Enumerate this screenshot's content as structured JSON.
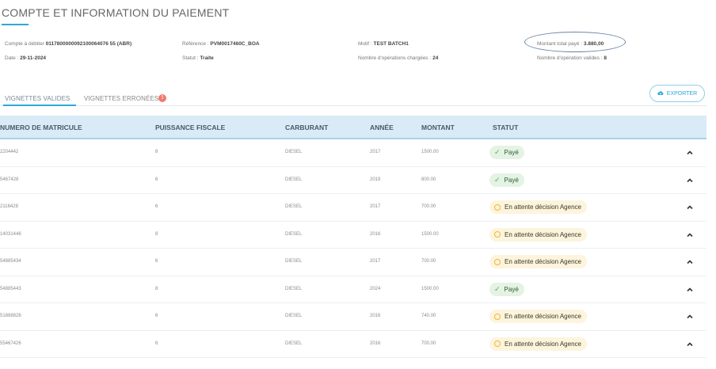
{
  "page": {
    "title": "COMPTE ET INFORMATION DU PAIEMENT"
  },
  "info": {
    "compte_label": "Compte à débiter",
    "compte_value": "0117800000092100064076 55 (ABR)",
    "date_label": "Date :",
    "date_value": "29-11-2024",
    "reference_label": "Référence :",
    "reference_value": "PVM0017460C_BOA",
    "statut_label": "Statut :",
    "statut_value": "Traite",
    "motif_label": "Motif :",
    "motif_value": "TEST BATCH1",
    "nb_chargees_label": "Nombre d'opérations chargées :",
    "nb_chargees_value": "24",
    "montant_label": "Montant total payé :",
    "montant_value": "3.880,00",
    "nb_valides_label": "Nombre d'opération valides :",
    "nb_valides_value": "8"
  },
  "tabs": [
    {
      "label": "VIGNETTES VALIDES"
    },
    {
      "label": "VIGNETTES ERRONÉES",
      "badge": "!"
    }
  ],
  "export_label": "EXPORTER",
  "table": {
    "headers": [
      "NUMERO DE MATRICULE",
      "PUISSANCE FISCALE",
      "CARBURANT",
      "ANNÉE",
      "MONTANT",
      "STATUT"
    ],
    "rows": [
      {
        "matricule": "2204442",
        "puissance": "8",
        "carburant": "DIESEL",
        "annee": "2017",
        "montant": "1500.00",
        "statut": "Payé",
        "type": "ok"
      },
      {
        "matricule": "5467428",
        "puissance": "6",
        "carburant": "DIESEL",
        "annee": "2019",
        "montant": "800.00",
        "statut": "Payé",
        "type": "ok"
      },
      {
        "matricule": "2116428",
        "puissance": "6",
        "carburant": "DIESEL",
        "annee": "2017",
        "montant": "700.00",
        "statut": "En attente décision Agence",
        "type": "wait"
      },
      {
        "matricule": "14031446",
        "puissance": "8",
        "carburant": "DIESEL",
        "annee": "2016",
        "montant": "1500.00",
        "statut": "En attente décision Agence",
        "type": "wait"
      },
      {
        "matricule": "54885434",
        "puissance": "6",
        "carburant": "DIESEL",
        "annee": "2017",
        "montant": "700.00",
        "statut": "En attente décision Agence",
        "type": "wait"
      },
      {
        "matricule": "54885443",
        "puissance": "8",
        "carburant": "DIESEL",
        "annee": "2024",
        "montant": "1500.00",
        "statut": "Payé",
        "type": "ok"
      },
      {
        "matricule": "51888826",
        "puissance": "6",
        "carburant": "DIESEL",
        "annee": "2016",
        "montant": "740.00",
        "statut": "En attente décision Agence",
        "type": "wait"
      },
      {
        "matricule": "55467426",
        "puissance": "6",
        "carburant": "DIESEL",
        "annee": "2016",
        "montant": "700.00",
        "statut": "En attente décision Agence",
        "type": "wait"
      }
    ]
  },
  "colors": {
    "accent": "#2da8d8",
    "header_bg": "#d8ebf6",
    "ok_bg": "#e4f3e4",
    "wait_bg": "#fcf4dc",
    "ellipse": "#6a86a8"
  },
  "icons": {
    "export": "cloud-download-icon",
    "ok": "check-icon",
    "wait": "clock-circle-icon",
    "row_toggle": "chevron-up-icon"
  }
}
